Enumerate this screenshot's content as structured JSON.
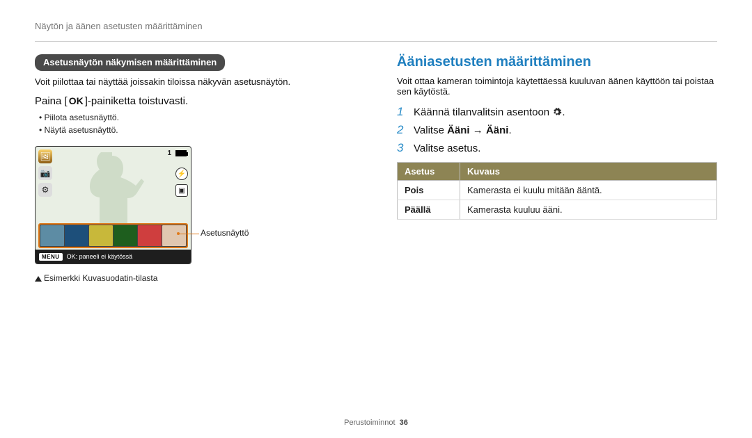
{
  "breadcrumb": "Näytön ja äänen asetusten määrittäminen",
  "left": {
    "sub_header": "Asetusnäytön näkymisen määrittäminen",
    "intro": "Voit piilottaa tai näyttää joissakin tiloissa näkyvän asetusnäytön.",
    "press_prefix": "Paina [",
    "ok_label": "OK",
    "press_suffix": "]-painiketta toistuvasti.",
    "bullets": [
      "Piilota asetusnäyttö.",
      "Näytä asetusnäyttö."
    ],
    "camera": {
      "top_count": "1",
      "menu_label": "MENU",
      "bottom_text": "OK: paneeli ei käytössä",
      "filter_colors": [
        "#5d8ca4",
        "#1d4f7a",
        "#c8b83a",
        "#1e5e1e",
        "#cf3e3e",
        "#e0c7b0"
      ]
    },
    "filter_strip_label": "Asetusnäyttö",
    "caption": "Esimerkki Kuvasuodatin-tilasta"
  },
  "right": {
    "section_title": "Ääniasetusten määrittäminen",
    "intro": "Voit ottaa kameran toimintoja käytettäessä kuuluvan äänen käyttöön tai poistaa sen käytöstä.",
    "steps": [
      {
        "num": "1",
        "text_pre": "Käännä tilanvalitsin asentoon ",
        "gear": true,
        "text_post": "."
      },
      {
        "num": "2",
        "text_pre": "Valitse ",
        "bold1": "Ääni",
        "arrow": " → ",
        "bold2": "Ääni",
        "text_post": "."
      },
      {
        "num": "3",
        "text_pre": "Valitse asetus.",
        "text_post": ""
      }
    ],
    "table": {
      "h1": "Asetus",
      "h2": "Kuvaus",
      "rows": [
        {
          "label": "Pois",
          "desc": "Kamerasta ei kuulu mitään ääntä."
        },
        {
          "label": "Päällä",
          "desc": "Kamerasta kuuluu ääni."
        }
      ]
    }
  },
  "footer": {
    "section": "Perustoiminnot",
    "page": "36"
  }
}
